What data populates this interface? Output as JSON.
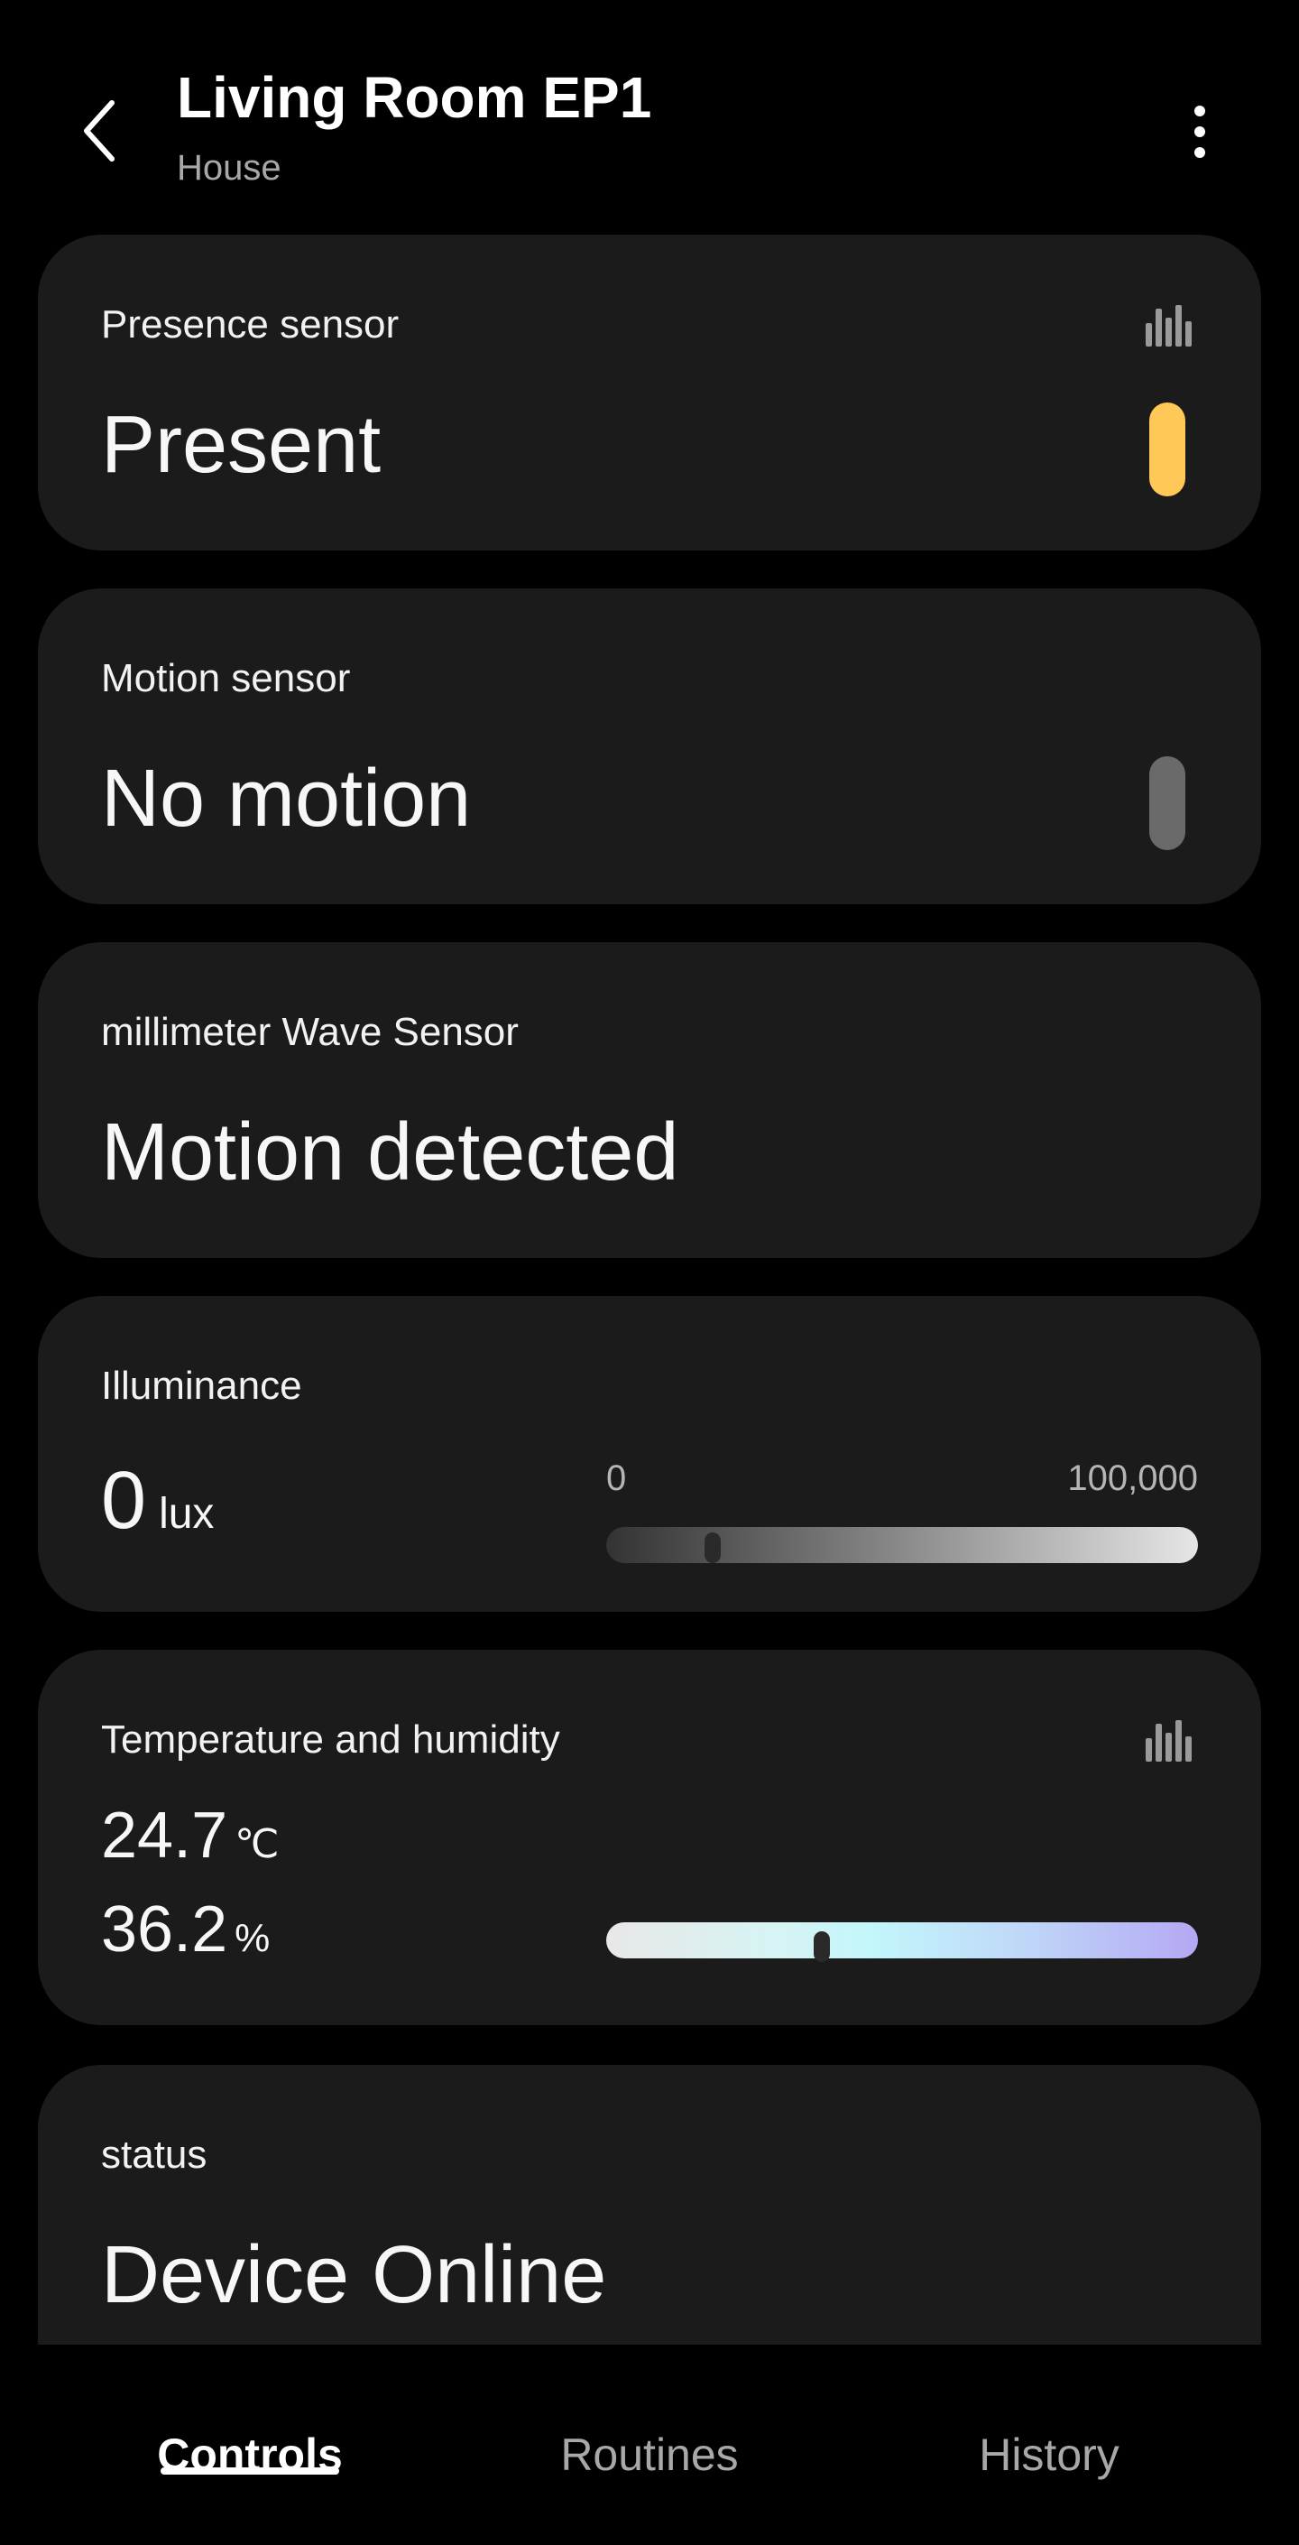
{
  "header": {
    "title": "Living Room EP1",
    "subtitle": "House",
    "back_icon": "chevron-left-icon",
    "more_icon": "more-vertical-icon"
  },
  "cards": {
    "presence": {
      "label": "Presence sensor",
      "value": "Present",
      "indicator_color": "#ffc857",
      "history_icon": "bar-chart-icon"
    },
    "motion": {
      "label": "Motion sensor",
      "value": "No motion",
      "indicator_color": "#6a6a6a"
    },
    "mmwave": {
      "label": "millimeter Wave Sensor",
      "value": "Motion detected"
    },
    "illuminance": {
      "label": "Illuminance",
      "value": "0",
      "unit": "lux",
      "range_min": "0",
      "range_max": "100,000",
      "level_fraction": 0.18
    },
    "temperature_humidity": {
      "label": "Temperature and humidity",
      "temperature": "24.7",
      "temperature_unit": "℃",
      "humidity": "36.2",
      "humidity_unit": "%",
      "level_fraction": 0.365,
      "history_icon": "bar-chart-icon"
    },
    "status": {
      "label": "status",
      "value": "Device Online"
    }
  },
  "tabs": [
    {
      "label": "Controls",
      "active": true
    },
    {
      "label": "Routines",
      "active": false
    },
    {
      "label": "History",
      "active": false
    }
  ],
  "colors": {
    "background": "#000000",
    "card": "#1b1b1b",
    "accent_present": "#ffc857",
    "inactive_text": "#a8a8a8"
  }
}
